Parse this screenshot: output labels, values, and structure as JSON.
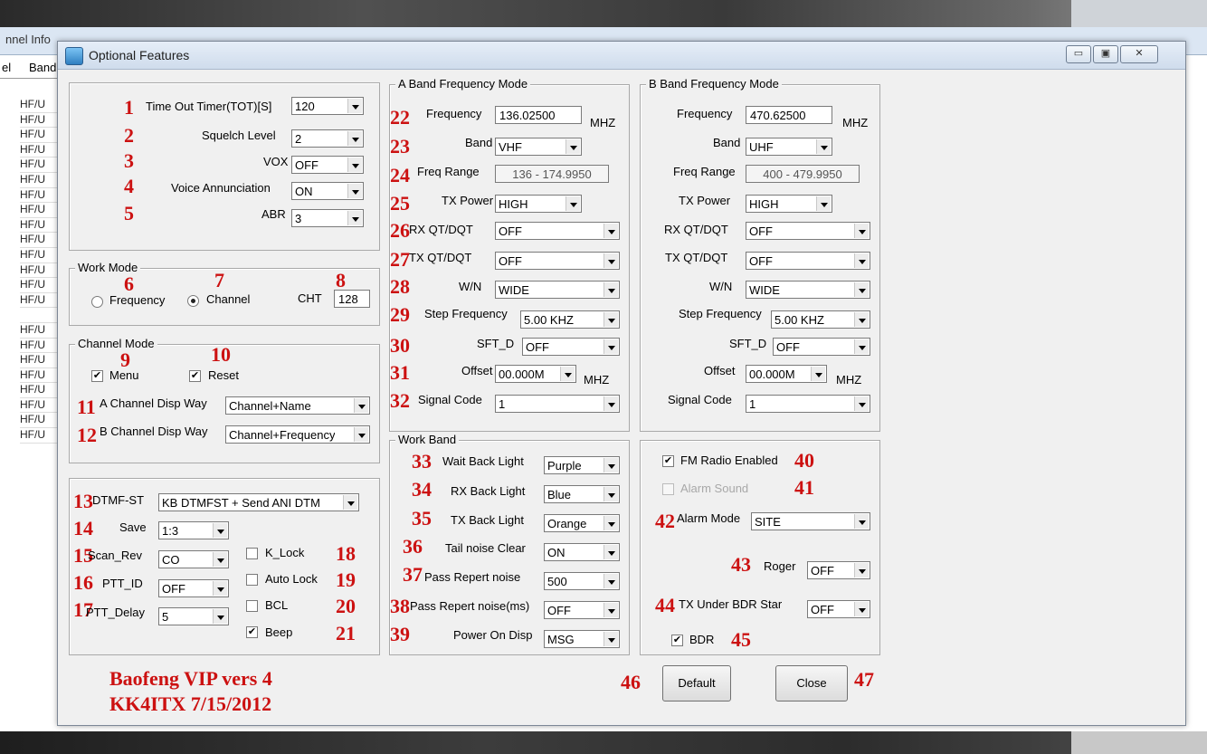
{
  "background_app": {
    "title_fragment": "nnel Info",
    "col1": "el",
    "col2": "Band",
    "rows": [
      "HF/U",
      "HF/U",
      "HF/U",
      "HF/U",
      "HF/U",
      "HF/U",
      "HF/U",
      "HF/U",
      "HF/U",
      "HF/U",
      "HF/U",
      "HF/U",
      "HF/U",
      "HF/U",
      "",
      "HF/U",
      "HF/U",
      "HF/U",
      "HF/U",
      "HF/U",
      "HF/U",
      "HF/U",
      "HF/U"
    ]
  },
  "dialog": {
    "title": "Optional Features",
    "minimize": "▭",
    "maximize": "▣",
    "close": "✕"
  },
  "general": {
    "tot_label": "Time Out Timer(TOT)[S]",
    "tot_value": "120",
    "squelch_label": "Squelch Level",
    "squelch_value": "2",
    "vox_label": "VOX",
    "vox_value": "OFF",
    "voice_label": "Voice Annunciation",
    "voice_value": "ON",
    "abr_label": "ABR",
    "abr_value": "3"
  },
  "work_mode": {
    "title": "Work Mode",
    "frequency_label": "Frequency",
    "channel_label": "Channel",
    "cht_label": "CHT",
    "cht_value": "128",
    "selected": "Channel"
  },
  "channel_mode": {
    "title": "Channel Mode",
    "menu_label": "Menu",
    "menu_checked": true,
    "reset_label": "Reset",
    "reset_checked": true,
    "a_disp_label": "A Channel Disp Way",
    "a_disp_value": "Channel+Name",
    "b_disp_label": "B Channel Disp Way",
    "b_disp_value": "Channel+Frequency"
  },
  "misc": {
    "dtmf_label": "DTMF-ST",
    "dtmf_value": "KB DTMFST + Send ANI DTM",
    "save_label": "Save",
    "save_value": "1:3",
    "scanrev_label": "Scan_Rev",
    "scanrev_value": "CO",
    "pttid_label": "PTT_ID",
    "pttid_value": "OFF",
    "pttdelay_label": "PTT_Delay",
    "pttdelay_value": "5",
    "klock_label": "K_Lock",
    "klock_checked": false,
    "autolock_label": "Auto Lock",
    "autolock_checked": false,
    "bcl_label": "BCL",
    "bcl_checked": false,
    "beep_label": "Beep",
    "beep_checked": true
  },
  "a_band": {
    "title": "A Band Frequency Mode",
    "freq_label": "Frequency",
    "freq_value": "136.02500",
    "freq_unit": "MHZ",
    "band_label": "Band",
    "band_value": "VHF",
    "range_label": "Freq Range",
    "range_value": "136 - 174.9950",
    "txpower_label": "TX Power",
    "txpower_value": "HIGH",
    "rxqt_label": "RX QT/DQT",
    "rxqt_value": "OFF",
    "txqt_label": "TX QT/DQT",
    "txqt_value": "OFF",
    "wn_label": "W/N",
    "wn_value": "WIDE",
    "step_label": "Step Frequency",
    "step_value": "5.00 KHZ",
    "sftd_label": "SFT_D",
    "sftd_value": "OFF",
    "offset_label": "Offset",
    "offset_value": "00.000M",
    "offset_unit": "MHZ",
    "sigcode_label": "Signal Code",
    "sigcode_value": "1"
  },
  "b_band": {
    "title": "B Band Frequency Mode",
    "freq_label": "Frequency",
    "freq_value": "470.62500",
    "freq_unit": "MHZ",
    "band_label": "Band",
    "band_value": "UHF",
    "range_label": "Freq Range",
    "range_value": "400 - 479.9950",
    "txpower_label": "TX Power",
    "txpower_value": "HIGH",
    "rxqt_label": "RX QT/DQT",
    "rxqt_value": "OFF",
    "txqt_label": "TX QT/DQT",
    "txqt_value": "OFF",
    "wn_label": "W/N",
    "wn_value": "WIDE",
    "step_label": "Step Frequency",
    "step_value": "5.00 KHZ",
    "sftd_label": "SFT_D",
    "sftd_value": "OFF",
    "offset_label": "Offset",
    "offset_value": "00.000M",
    "offset_unit": "MHZ",
    "sigcode_label": "Signal Code",
    "sigcode_value": "1"
  },
  "work_band": {
    "title": "Work Band",
    "wait_label": "Wait Back Light",
    "wait_value": "Purple",
    "rx_label": "RX Back Light",
    "rx_value": "Blue",
    "tx_label": "TX Back Light",
    "tx_value": "Orange",
    "tail_label": "Tail noise Clear",
    "tail_value": "ON",
    "pass1_label": "Pass Repert noise",
    "pass1_value": "500",
    "pass2_label": "Pass Repert noise(ms)",
    "pass2_value": "OFF",
    "poweron_label": "Power On Disp",
    "poweron_value": "MSG"
  },
  "radio_opts": {
    "fm_label": "FM Radio Enabled",
    "fm_checked": true,
    "alarm_sound_label": "Alarm Sound",
    "alarm_sound_checked": false,
    "alarm_mode_label": "Alarm Mode",
    "alarm_mode_value": "SITE",
    "roger_label": "Roger",
    "roger_value": "OFF",
    "txbdr_label": "TX Under BDR Star",
    "txbdr_value": "OFF",
    "bdr_label": "BDR",
    "bdr_checked": true
  },
  "buttons": {
    "default_label": "Default",
    "close_label": "Close"
  },
  "annotation": {
    "line1": "Baofeng VIP vers 4",
    "line2": "KK4ITX  7/15/2012"
  },
  "markers": [
    "1",
    "2",
    "3",
    "4",
    "5",
    "6",
    "7",
    "8",
    "9",
    "10",
    "11",
    "12",
    "13",
    "14",
    "15",
    "16",
    "17",
    "18",
    "19",
    "20",
    "21",
    "22",
    "23",
    "24",
    "25",
    "26",
    "27",
    "28",
    "29",
    "30",
    "31",
    "32",
    "33",
    "34",
    "35",
    "36",
    "37",
    "38",
    "39",
    "40",
    "41",
    "42",
    "43",
    "44",
    "45",
    "46",
    "47"
  ],
  "colors": {
    "marker_red": "#cc1111",
    "dialog_bg": "#f0f0f0",
    "title_bar": "#d9e4f1"
  }
}
